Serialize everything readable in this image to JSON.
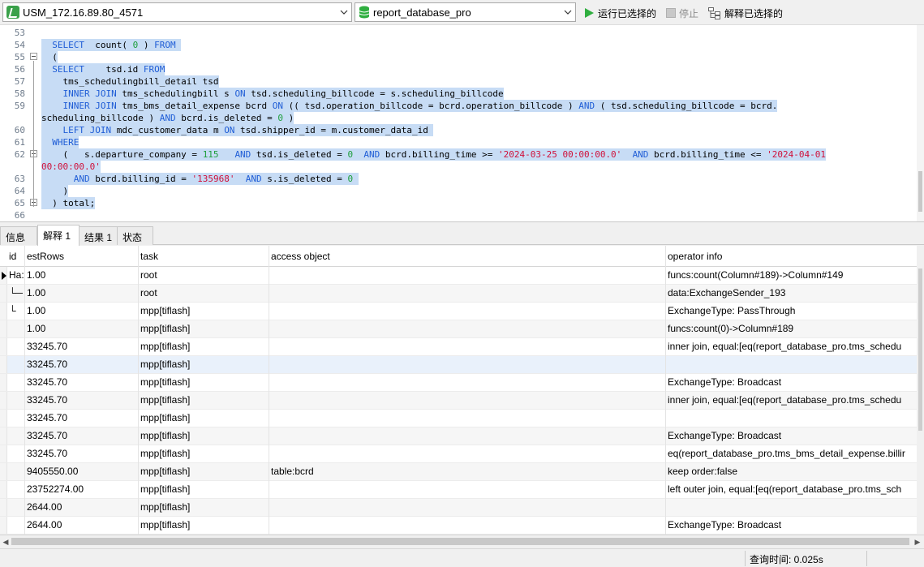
{
  "toolbar": {
    "connection": "USM_172.16.89.80_4571",
    "database": "report_database_pro",
    "run_selected": "运行已选择的",
    "stop": "停止",
    "explain_selected": "解释已选择的"
  },
  "colors": {
    "keyword": "#1f5dd6",
    "number": "#1e9e3c",
    "string": "#d0103a",
    "selection": "#c7dcf5",
    "run_icon": "#2fae3f"
  },
  "editor": {
    "line_numbers": [
      "53",
      "54",
      "55",
      "56",
      "57",
      "58",
      "59",
      "",
      "60",
      "61",
      "62",
      "",
      "63",
      "64",
      "65",
      "66"
    ],
    "lines": [
      [],
      [
        {
          "t": "  ",
          "c": "p"
        },
        {
          "t": "SELECT",
          "c": "kw"
        },
        {
          "t": "  count( ",
          "c": "p"
        },
        {
          "t": "0",
          "c": "num"
        },
        {
          "t": " ) ",
          "c": "p"
        },
        {
          "t": "FROM",
          "c": "kw"
        },
        {
          "t": " ",
          "c": "p"
        }
      ],
      [
        {
          "t": "  (",
          "c": "p"
        }
      ],
      [
        {
          "t": "  ",
          "c": "p"
        },
        {
          "t": "SELECT",
          "c": "kw"
        },
        {
          "t": "    tsd.id ",
          "c": "p"
        },
        {
          "t": "FROM",
          "c": "kw"
        }
      ],
      [
        {
          "t": "    tms_schedulingbill_detail tsd",
          "c": "p"
        }
      ],
      [
        {
          "t": "    ",
          "c": "p"
        },
        {
          "t": "INNER JOIN",
          "c": "kw"
        },
        {
          "t": " tms_schedulingbill s ",
          "c": "p"
        },
        {
          "t": "ON",
          "c": "kw"
        },
        {
          "t": " tsd.scheduling_billcode = s.scheduling_billcode",
          "c": "p"
        }
      ],
      [
        {
          "t": "    ",
          "c": "p"
        },
        {
          "t": "INNER JOIN",
          "c": "kw"
        },
        {
          "t": " tms_bms_detail_expense bcrd ",
          "c": "p"
        },
        {
          "t": "ON",
          "c": "kw"
        },
        {
          "t": " (( tsd.operation_billcode = bcrd.operation_billcode ) ",
          "c": "p"
        },
        {
          "t": "AND",
          "c": "kw"
        },
        {
          "t": " ( tsd.scheduling_billcode = bcrd.",
          "c": "p"
        }
      ],
      [
        {
          "t": "scheduling_billcode ) ",
          "c": "p"
        },
        {
          "t": "AND",
          "c": "kw"
        },
        {
          "t": " bcrd.is_deleted = ",
          "c": "p"
        },
        {
          "t": "0",
          "c": "num"
        },
        {
          "t": " )",
          "c": "p"
        }
      ],
      [
        {
          "t": "    ",
          "c": "p"
        },
        {
          "t": "LEFT JOIN",
          "c": "kw"
        },
        {
          "t": " mdc_customer_data m ",
          "c": "p"
        },
        {
          "t": "ON",
          "c": "kw"
        },
        {
          "t": " tsd.shipper_id = m.customer_data_id ",
          "c": "p"
        }
      ],
      [
        {
          "t": "  ",
          "c": "p"
        },
        {
          "t": "WHERE",
          "c": "kw"
        }
      ],
      [
        {
          "t": "    (   s.departure_company = ",
          "c": "p"
        },
        {
          "t": "115",
          "c": "num"
        },
        {
          "t": "   ",
          "c": "p"
        },
        {
          "t": "AND",
          "c": "kw"
        },
        {
          "t": " tsd.is_deleted = ",
          "c": "p"
        },
        {
          "t": "0",
          "c": "num"
        },
        {
          "t": "  ",
          "c": "p"
        },
        {
          "t": "AND",
          "c": "kw"
        },
        {
          "t": " bcrd.billing_time >= ",
          "c": "p"
        },
        {
          "t": "'2024-03-25 00:00:00.0'",
          "c": "str"
        },
        {
          "t": "  ",
          "c": "p"
        },
        {
          "t": "AND",
          "c": "kw"
        },
        {
          "t": " bcrd.billing_time <= ",
          "c": "p"
        },
        {
          "t": "'2024-04-01",
          "c": "str"
        }
      ],
      [
        {
          "t": "00:00:00.0'",
          "c": "str"
        }
      ],
      [
        {
          "t": "      ",
          "c": "p"
        },
        {
          "t": "AND",
          "c": "kw"
        },
        {
          "t": " bcrd.billing_id = ",
          "c": "p"
        },
        {
          "t": "'135968'",
          "c": "str"
        },
        {
          "t": "  ",
          "c": "p"
        },
        {
          "t": "AND",
          "c": "kw"
        },
        {
          "t": " s.is_deleted = ",
          "c": "p"
        },
        {
          "t": "0",
          "c": "num"
        },
        {
          "t": " ",
          "c": "p"
        }
      ],
      [
        {
          "t": "    )",
          "c": "p"
        }
      ],
      [
        {
          "t": "  ) total;",
          "c": "p"
        }
      ],
      []
    ]
  },
  "tabs": [
    "信息",
    "解释 1",
    "结果 1",
    "状态"
  ],
  "grid": {
    "columns": [
      "id",
      "estRows",
      "task",
      "access object",
      "operator info"
    ],
    "rows": [
      {
        "id": "Ha:",
        "estRows": "1.00",
        "task": "root",
        "access": "",
        "info": "funcs:count(Column#189)->Column#149"
      },
      {
        "id": "└─",
        "estRows": "1.00",
        "task": "root",
        "access": "",
        "info": "data:ExchangeSender_193"
      },
      {
        "id": "  └",
        "estRows": "1.00",
        "task": "mpp[tiflash]",
        "access": "",
        "info": "ExchangeType: PassThrough"
      },
      {
        "id": "",
        "estRows": "1.00",
        "task": "mpp[tiflash]",
        "access": "",
        "info": "funcs:count(0)->Column#189"
      },
      {
        "id": "",
        "estRows": "33245.70",
        "task": "mpp[tiflash]",
        "access": "",
        "info": "inner join, equal:[eq(report_database_pro.tms_schedu"
      },
      {
        "id": "",
        "estRows": "33245.70",
        "task": "mpp[tiflash]",
        "access": "",
        "info": ""
      },
      {
        "id": "",
        "estRows": "33245.70",
        "task": "mpp[tiflash]",
        "access": "",
        "info": "ExchangeType: Broadcast"
      },
      {
        "id": "",
        "estRows": "33245.70",
        "task": "mpp[tiflash]",
        "access": "",
        "info": "inner join, equal:[eq(report_database_pro.tms_schedu"
      },
      {
        "id": "",
        "estRows": "33245.70",
        "task": "mpp[tiflash]",
        "access": "",
        "info": ""
      },
      {
        "id": "",
        "estRows": "33245.70",
        "task": "mpp[tiflash]",
        "access": "",
        "info": "ExchangeType: Broadcast"
      },
      {
        "id": "",
        "estRows": "33245.70",
        "task": "mpp[tiflash]",
        "access": "",
        "info": "eq(report_database_pro.tms_bms_detail_expense.billir"
      },
      {
        "id": "",
        "estRows": "9405550.00",
        "task": "mpp[tiflash]",
        "access": "table:bcrd",
        "info": "keep order:false"
      },
      {
        "id": "",
        "estRows": "23752274.00",
        "task": "mpp[tiflash]",
        "access": "",
        "info": "left outer join, equal:[eq(report_database_pro.tms_sch"
      },
      {
        "id": "",
        "estRows": "2644.00",
        "task": "mpp[tiflash]",
        "access": "",
        "info": ""
      },
      {
        "id": "",
        "estRows": "2644.00",
        "task": "mpp[tiflash]",
        "access": "",
        "info": "ExchangeType: Broadcast"
      }
    ]
  },
  "status": {
    "query_time": "查询时间: 0.025s"
  }
}
